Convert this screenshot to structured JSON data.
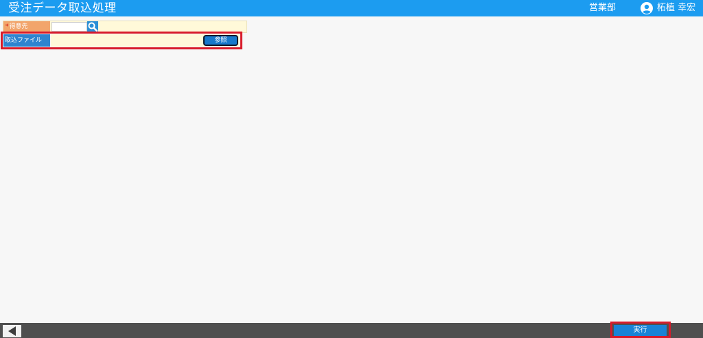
{
  "header": {
    "title": "受注データ取込処理",
    "department": "営業部",
    "user_name": "柘植 幸宏"
  },
  "form": {
    "customer": {
      "required_mark": "*",
      "label": "得意先",
      "value": ""
    },
    "import_file": {
      "label": "取込ファイル",
      "value": "",
      "browse_label": "参照"
    }
  },
  "footer": {
    "execute_label": "実行"
  },
  "icons": {
    "search": "search-icon",
    "user": "user-icon",
    "back": "back-arrow-icon"
  },
  "colors": {
    "header_bg": "#1c9cf0",
    "customer_label_bg": "#f2a56b",
    "file_label_bg": "#2e84cf",
    "field_bg": "#fff9d9",
    "highlight_border": "#d81b2a",
    "footer_bg": "#4f4f4f"
  }
}
